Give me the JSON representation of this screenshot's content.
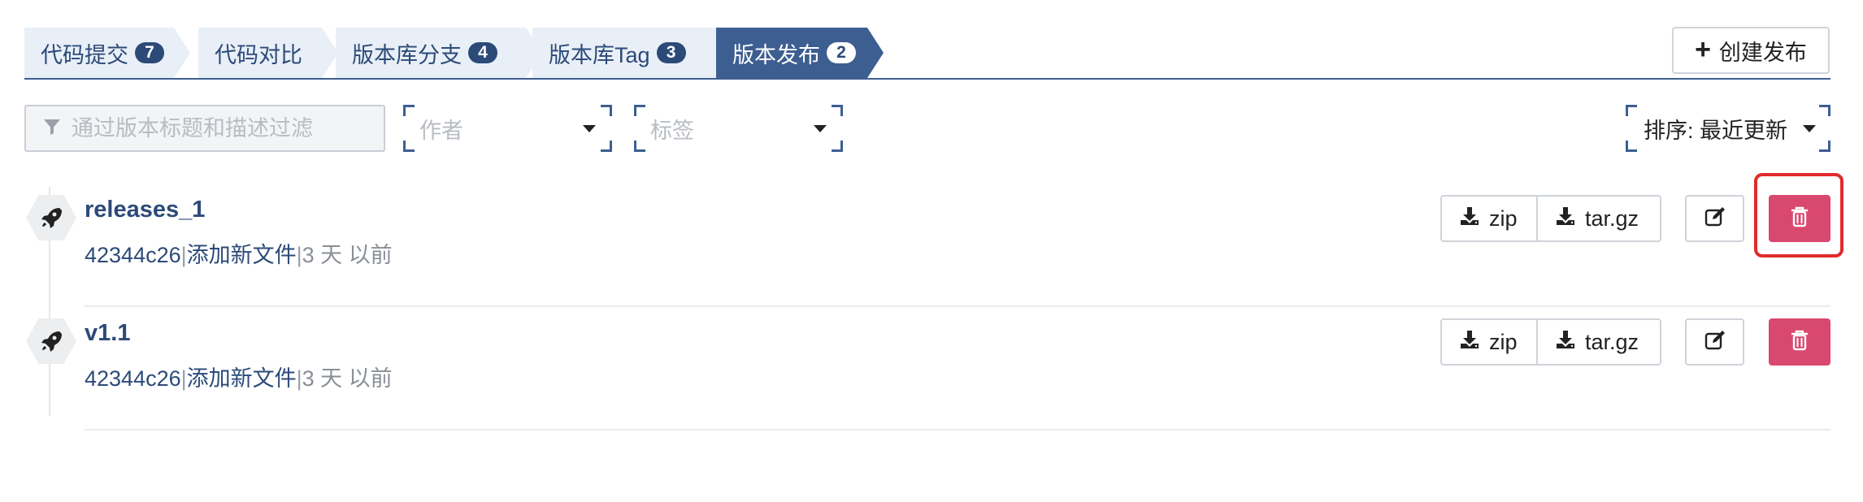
{
  "tabs": [
    {
      "label": "代码提交",
      "count": "7",
      "active": false
    },
    {
      "label": "代码对比",
      "count": "",
      "active": false
    },
    {
      "label": "版本库分支",
      "count": "4",
      "active": false
    },
    {
      "label": "版本库Tag",
      "count": "3",
      "active": false
    },
    {
      "label": "版本发布",
      "count": "2",
      "active": true
    }
  ],
  "create_button": {
    "label": "创建发布"
  },
  "filters": {
    "search_placeholder": "通过版本标题和描述过滤",
    "author_placeholder": "作者",
    "tag_placeholder": "标签",
    "sort_label": "排序: 最近更新"
  },
  "releases": [
    {
      "name": "releases_1",
      "commit": "42344c26",
      "message": "添加新文件",
      "separator": "|",
      "time": "3 天 以前"
    },
    {
      "name": "v1.1",
      "commit": "42344c26",
      "message": "添加新文件",
      "separator": "|",
      "time": "3 天 以前"
    }
  ],
  "download_buttons": {
    "zip": "zip",
    "tar": "tar.gz"
  },
  "colors": {
    "primary": "#3d5e91",
    "primary_dark": "#2c4a78",
    "danger": "#d9486e",
    "highlight": "#e22b2b"
  }
}
